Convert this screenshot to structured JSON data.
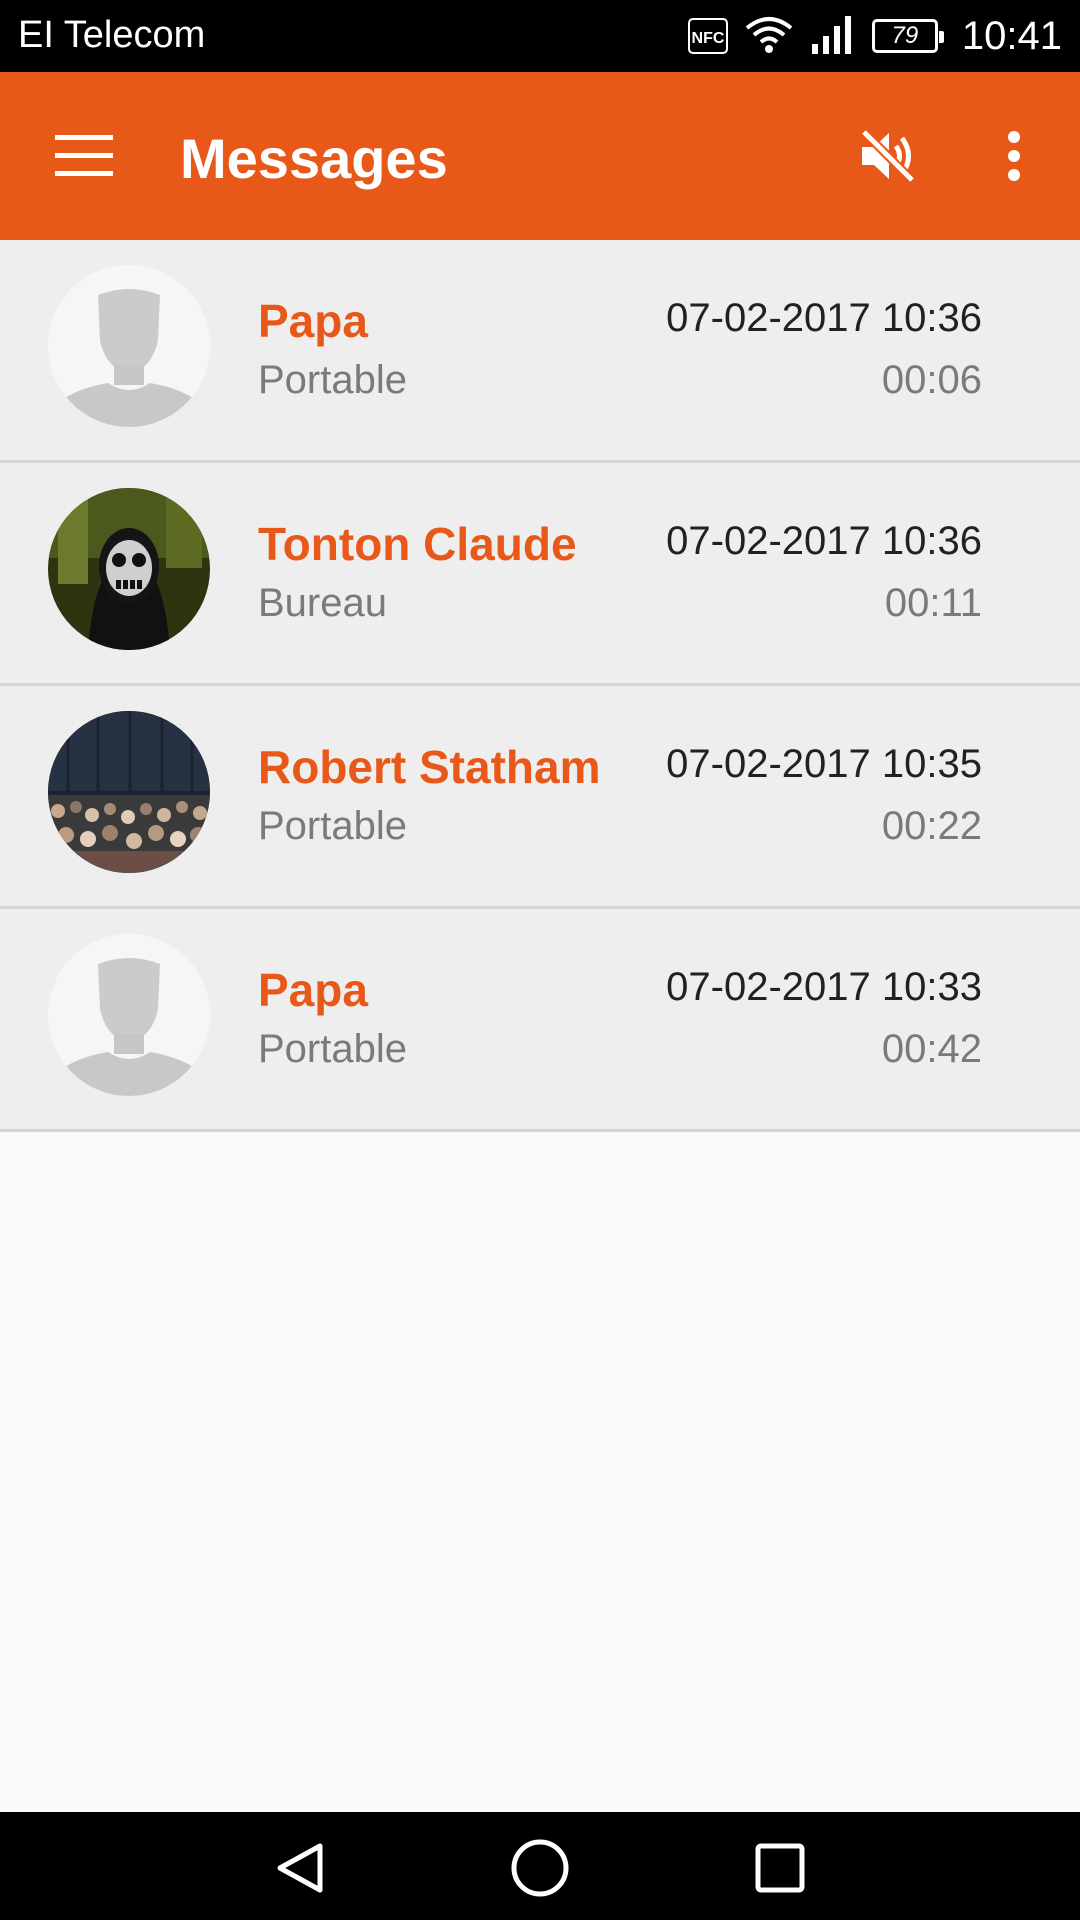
{
  "status_bar": {
    "carrier": "EI Telecom",
    "nfc_label": "NFC",
    "battery": "79",
    "time": "10:41"
  },
  "app_bar": {
    "title": "Messages",
    "background_color": "#e85819",
    "icons": [
      "menu-icon",
      "volume-off-icon",
      "more-vert-icon"
    ]
  },
  "messages": [
    {
      "name": "Papa",
      "type": "Portable",
      "datetime": "07-02-2017 10:36",
      "duration": "00:06",
      "avatar": "default-avatar"
    },
    {
      "name": "Tonton Claude",
      "type": "Bureau",
      "datetime": "07-02-2017 10:36",
      "duration": "00:11",
      "avatar": "skull-mask-photo"
    },
    {
      "name": "Robert Statham",
      "type": "Portable",
      "datetime": "07-02-2017 10:35",
      "duration": "00:22",
      "avatar": "crowd-photo"
    },
    {
      "name": "Papa",
      "type": "Portable",
      "datetime": "07-02-2017 10:33",
      "duration": "00:42",
      "avatar": "default-avatar"
    }
  ],
  "nav_bar": {
    "icons": [
      "back-icon",
      "home-icon",
      "recents-icon"
    ]
  }
}
